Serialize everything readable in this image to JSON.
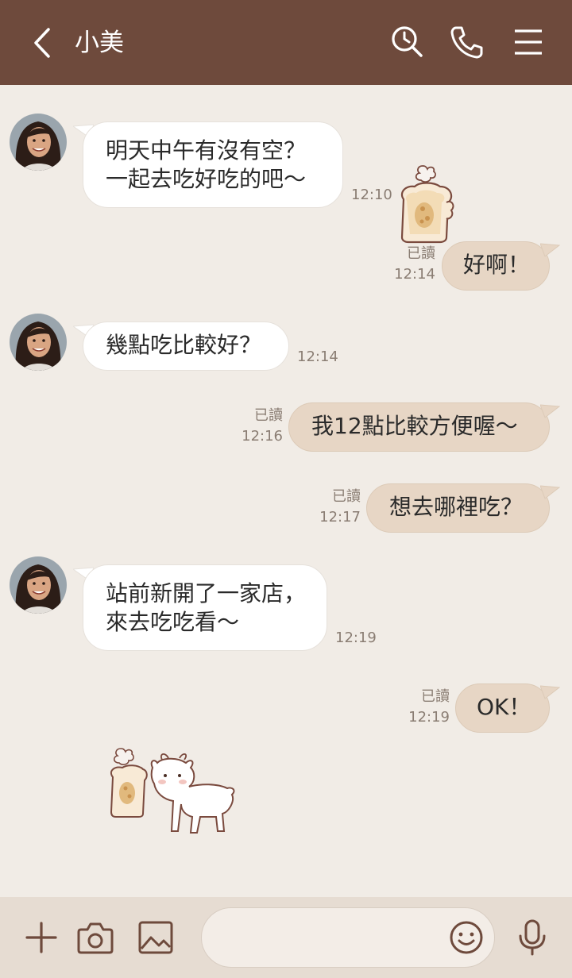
{
  "header": {
    "title": "小美",
    "icons": [
      "back-icon",
      "search-icon",
      "phone-icon",
      "menu-icon"
    ]
  },
  "messages": [
    {
      "side": "in",
      "lines": [
        "明天中午有沒有空？",
        "一起去吃好吃的吧〜"
      ],
      "time": "12:10"
    },
    {
      "side": "out",
      "type": "sticker",
      "sticker": "toast-sticker"
    },
    {
      "side": "out",
      "text": "好啊！",
      "read": "已讀",
      "time": "12:14"
    },
    {
      "side": "in",
      "text": "幾點吃比較好？",
      "time": "12:14"
    },
    {
      "side": "out",
      "text": "我12點比較方便喔〜",
      "read": "已讀",
      "time": "12:16"
    },
    {
      "side": "out",
      "text": "想去哪裡吃？",
      "read": "已讀",
      "time": "12:17"
    },
    {
      "side": "in",
      "lines": [
        "站前新開了一家店，",
        "來去吃吃看〜"
      ],
      "time": "12:19"
    },
    {
      "side": "out",
      "text": "OK！",
      "read": "已讀",
      "time": "12:19"
    },
    {
      "side": "in",
      "type": "sticker",
      "sticker": "toast-and-goat-sticker"
    }
  ],
  "input": {
    "value": "",
    "placeholder": ""
  },
  "bottom_icons": [
    "plus-icon",
    "camera-icon",
    "image-icon",
    "emoji-icon",
    "microphone-icon"
  ],
  "colors": {
    "header": "#6e4a3c",
    "background": "#f1ece6",
    "outgoing_bubble": "#e7d6c5",
    "incoming_bubble": "#ffffff",
    "bottom_bar": "#e6dcd2"
  }
}
